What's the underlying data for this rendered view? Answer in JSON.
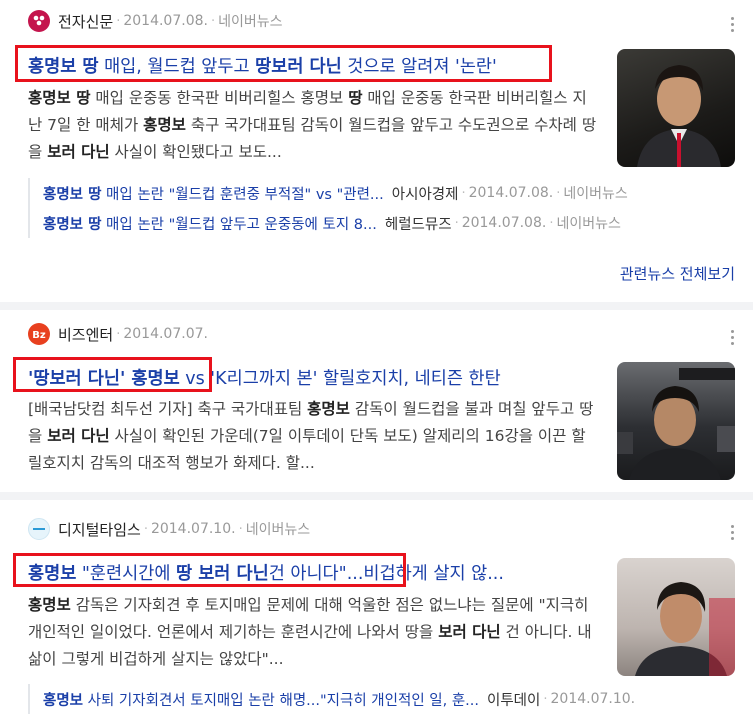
{
  "results": [
    {
      "source": "전자신문",
      "date": "2014.07.08.",
      "portal": "네이버뉴스",
      "title": [
        "홍명보 땅",
        " 매입, 월드컵 앞두고 ",
        "땅보러 다닌",
        " 것으로 알려져 '논란'"
      ],
      "desc": [
        "홍명보 ",
        "땅",
        " 매입 운중동 한국판 비버리힐스 홍명보 ",
        "땅",
        " 매입 운중동 한국판 비버리힐스 지난 7일 한 매체가 ",
        "홍명보",
        " 축구 국가대표팀 감독이 월드컵을 앞두고 수도권으로 수차례 땅을 ",
        "보러 다닌",
        " 사실이 확인됐다고 보도..."
      ],
      "related": [
        {
          "title": [
            "홍명보 땅",
            " 매입 논란 \"월드컵 훈련중 부적절\" vs \"관련..."
          ],
          "source": "아시아경제",
          "date": "2014.07.08.",
          "portal": "네이버뉴스"
        },
        {
          "title": [
            "홍명보 땅",
            " 매입 논란 \"월드컵 앞두고 운중동에 토지 8..."
          ],
          "source": "헤럴드뮤즈",
          "date": "2014.07.08.",
          "portal": "네이버뉴스"
        }
      ],
      "more_label": "관련뉴스 전체보기"
    },
    {
      "source": "비즈엔터",
      "date": "2014.07.07.",
      "title": [
        "'땅보러 다닌' 홍명보",
        " vs 'K리그까지 본' 할릴호지치, 네티즌 한탄"
      ],
      "desc": [
        "[배국남닷컴 최두선 기자] 축구 국가대표팀 ",
        "홍명보",
        " 감독이 월드컵을 불과 며칠 앞두고 땅을 ",
        "보러 다닌",
        " 사실이 확인된 가운데(7일 이투데이 단독 보도) 알제리의 16강을 이끈 할릴호지치 감독의 대조적 행보가 화제다. 할..."
      ]
    },
    {
      "source": "디지털타임스",
      "date": "2014.07.10.",
      "portal": "네이버뉴스",
      "title": [
        "홍명보",
        " \"훈련시간에 ",
        "땅 보러 다닌",
        "건 아니다\"...비겁하게 살지 않..."
      ],
      "desc": [
        "홍명보",
        " 감독은 기자회견 후 토지매입 문제에 대해 억울한 점은 없느냐는 질문에 \"지극히 개인적인 일이었다. 언론에서 제기하는 훈련시간에 나와서 땅을 ",
        "보러 다닌",
        " 건 아니다. 내 삶이 그렇게 비겁하게 살지는 않았다\"..."
      ],
      "related": [
        {
          "title": [
            "홍명보",
            " 사퇴 기자회견서 토지매입 논란 해명...\"지극히 개인적인 일, 훈..."
          ],
          "source": "이투데이",
          "date": "2014.07.10."
        }
      ]
    }
  ],
  "colors": {
    "link": "#1a3fa8",
    "highlight_box": "#e8121c",
    "meta": "#999999"
  }
}
